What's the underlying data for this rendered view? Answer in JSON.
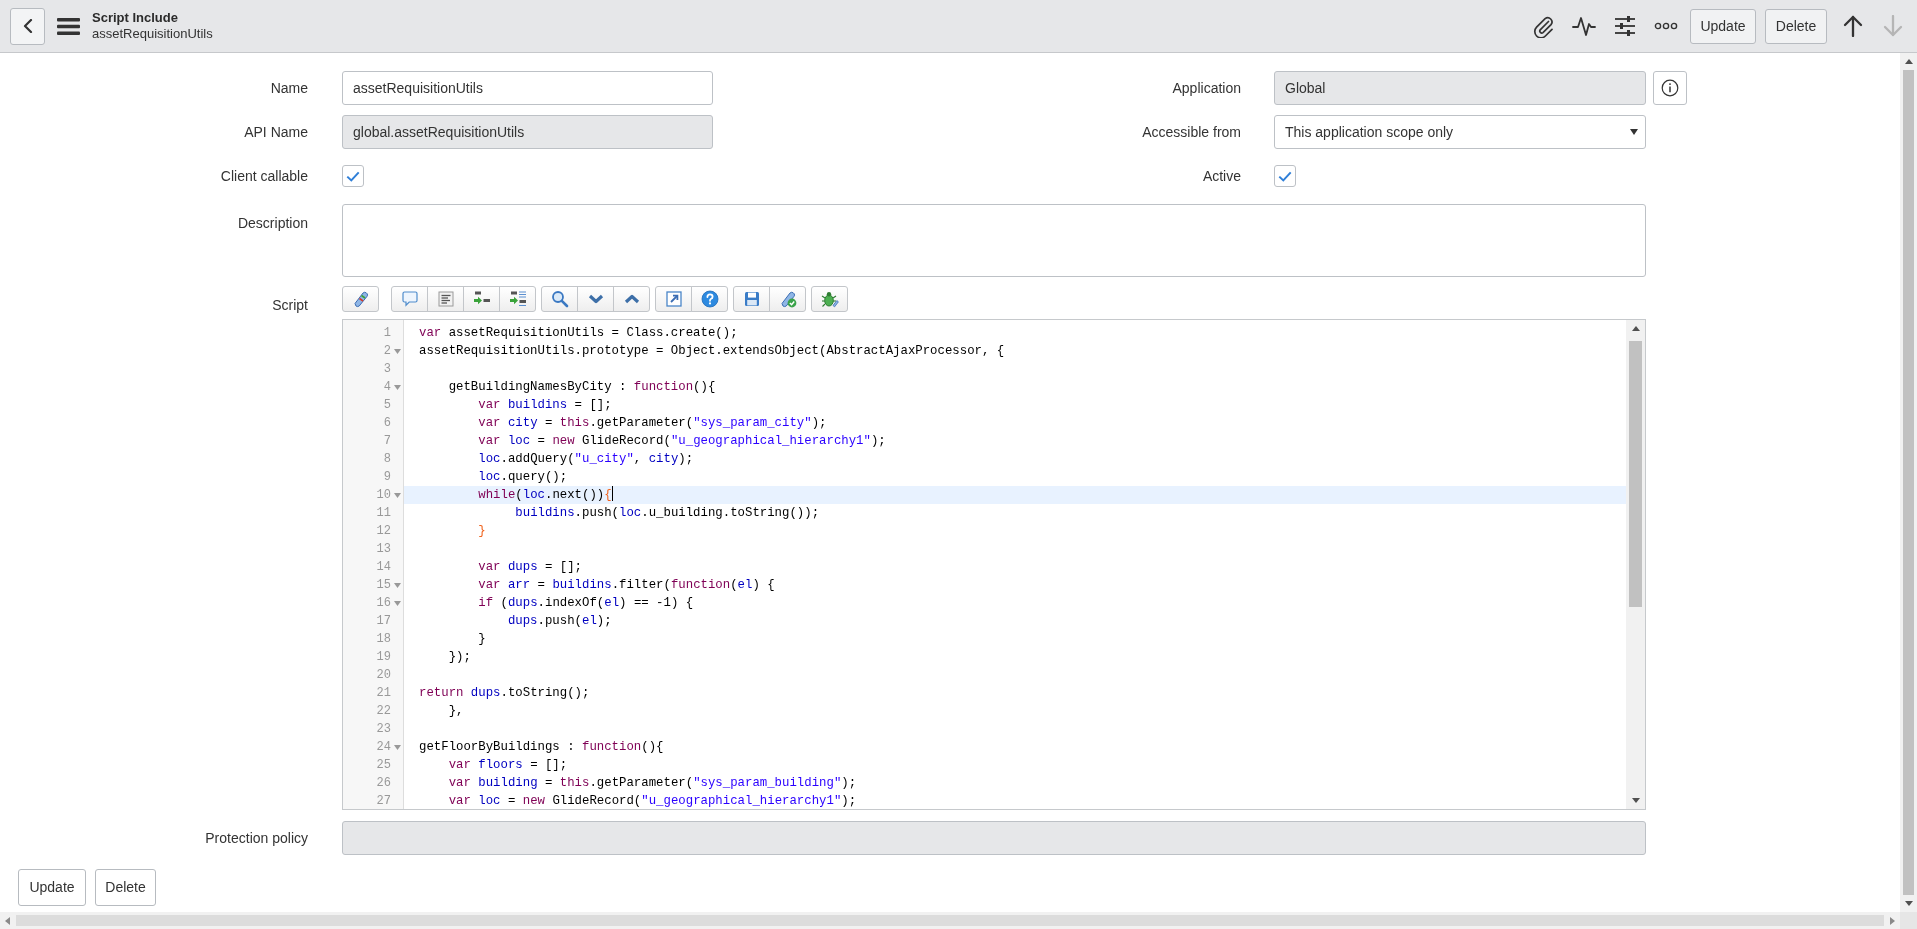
{
  "header": {
    "title": "Script Include",
    "subtitle": "assetRequisitionUtils",
    "buttons": [
      "Update",
      "Delete"
    ],
    "previous_record": {
      "disabled": false
    },
    "next_record": {
      "disabled": true
    }
  },
  "form": {
    "name": {
      "label": "Name",
      "value": "assetRequisitionUtils",
      "read_only": false
    },
    "application": {
      "label": "Application",
      "value": "Global",
      "read_only": true
    },
    "api_name": {
      "label": "API Name",
      "value": "global.assetRequisitionUtils",
      "read_only": true
    },
    "accessible_from": {
      "label": "Accessible from",
      "value": "This application scope only"
    },
    "client_callable": {
      "label": "Client callable",
      "checked": true
    },
    "active": {
      "label": "Active",
      "checked": true
    },
    "description": {
      "label": "Description",
      "read_only": false
    },
    "script": {
      "label": "Script",
      "lines": [
        {
          "number": "1",
          "foldable": false,
          "active": false,
          "tokens": [
            {
              "kind": "keyword",
              "text": "var"
            },
            {
              "kind": "plain",
              "text": " assetRequisitionUtils = Class.create();"
            }
          ]
        },
        {
          "number": "2",
          "foldable": true,
          "active": false,
          "tokens": [
            {
              "kind": "plain",
              "text": "assetRequisitionUtils.prototype = Object.extendsObject(AbstractAjaxProcessor, {"
            }
          ]
        },
        {
          "number": "3",
          "foldable": false,
          "active": false
        },
        {
          "number": "4",
          "foldable": true,
          "active": false,
          "tokens": [
            {
              "kind": "plain",
              "text": "    getBuildingNamesByCity : "
            },
            {
              "kind": "keyword",
              "text": "function"
            },
            {
              "kind": "plain",
              "text": "(){"
            }
          ]
        },
        {
          "number": "5",
          "foldable": false,
          "active": false,
          "tokens": [
            {
              "kind": "keyword",
              "text": "        var"
            },
            {
              "kind": "variable",
              "text": " buildins"
            },
            {
              "kind": "plain",
              "text": " = [];"
            }
          ]
        },
        {
          "number": "6",
          "foldable": false,
          "active": false,
          "tokens": [
            {
              "kind": "keyword",
              "text": "        var"
            },
            {
              "kind": "variable",
              "text": " city"
            },
            {
              "kind": "plain",
              "text": " = "
            },
            {
              "kind": "keyword",
              "text": "this"
            },
            {
              "kind": "plain",
              "text": ".getParameter("
            },
            {
              "kind": "string",
              "text": "\"sys_param_city\""
            },
            {
              "kind": "plain",
              "text": ");"
            }
          ]
        },
        {
          "number": "7",
          "foldable": false,
          "active": false,
          "tokens": [
            {
              "kind": "keyword",
              "text": "        var"
            },
            {
              "kind": "variable",
              "text": " loc"
            },
            {
              "kind": "plain",
              "text": " = "
            },
            {
              "kind": "keyword",
              "text": "new"
            },
            {
              "kind": "plain",
              "text": " GlideRecord("
            },
            {
              "kind": "string",
              "text": "\"u_geographical_hierarchy1\""
            },
            {
              "kind": "plain",
              "text": ");"
            }
          ]
        },
        {
          "number": "8",
          "foldable": false,
          "active": false,
          "tokens": [
            {
              "kind": "variable",
              "text": "        loc"
            },
            {
              "kind": "plain",
              "text": ".addQuery("
            },
            {
              "kind": "string",
              "text": "\"u_city\""
            },
            {
              "kind": "plain",
              "text": ", "
            },
            {
              "kind": "variable",
              "text": "city"
            },
            {
              "kind": "plain",
              "text": ");"
            }
          ]
        },
        {
          "number": "9",
          "foldable": false,
          "active": false,
          "tokens": [
            {
              "kind": "variable",
              "text": "        loc"
            },
            {
              "kind": "plain",
              "text": ".query();"
            }
          ]
        },
        {
          "number": "10",
          "foldable": true,
          "active": true,
          "tokens": [
            {
              "kind": "keyword",
              "text": "        while"
            },
            {
              "kind": "plain",
              "text": "("
            },
            {
              "kind": "variable",
              "text": "loc"
            },
            {
              "kind": "plain",
              "text": ".next())"
            },
            {
              "kind": "bracket",
              "text": "{"
            }
          ]
        },
        {
          "number": "11",
          "foldable": false,
          "active": false,
          "tokens": [
            {
              "kind": "variable",
              "text": "             buildins"
            },
            {
              "kind": "plain",
              "text": ".push("
            },
            {
              "kind": "variable",
              "text": "loc"
            },
            {
              "kind": "plain",
              "text": ".u_building.toString());"
            }
          ]
        },
        {
          "number": "12",
          "foldable": false,
          "active": false,
          "tokens": [
            {
              "kind": "bracket",
              "text": "        }"
            }
          ]
        },
        {
          "number": "13",
          "foldable": false,
          "active": false
        },
        {
          "number": "14",
          "foldable": false,
          "active": false,
          "tokens": [
            {
              "kind": "keyword",
              "text": "        var"
            },
            {
              "kind": "variable",
              "text": " dups"
            },
            {
              "kind": "plain",
              "text": " = [];"
            }
          ]
        },
        {
          "number": "15",
          "foldable": true,
          "active": false,
          "tokens": [
            {
              "kind": "keyword",
              "text": "        var"
            },
            {
              "kind": "variable",
              "text": " arr"
            },
            {
              "kind": "plain",
              "text": " = "
            },
            {
              "kind": "variable",
              "text": "buildins"
            },
            {
              "kind": "plain",
              "text": ".filter("
            },
            {
              "kind": "keyword",
              "text": "function"
            },
            {
              "kind": "plain",
              "text": "("
            },
            {
              "kind": "variable",
              "text": "el"
            },
            {
              "kind": "plain",
              "text": ") {"
            }
          ]
        },
        {
          "number": "16",
          "foldable": true,
          "active": false,
          "tokens": [
            {
              "kind": "keyword",
              "text": "        if"
            },
            {
              "kind": "plain",
              "text": " ("
            },
            {
              "kind": "variable",
              "text": "dups"
            },
            {
              "kind": "plain",
              "text": ".indexOf("
            },
            {
              "kind": "variable",
              "text": "el"
            },
            {
              "kind": "plain",
              "text": ") == -1) {"
            }
          ]
        },
        {
          "number": "17",
          "foldable": false,
          "active": false,
          "tokens": [
            {
              "kind": "variable",
              "text": "            dups"
            },
            {
              "kind": "plain",
              "text": ".push("
            },
            {
              "kind": "variable",
              "text": "el"
            },
            {
              "kind": "plain",
              "text": ");"
            }
          ]
        },
        {
          "number": "18",
          "foldable": false,
          "active": false,
          "tokens": [
            {
              "kind": "plain",
              "text": "        }"
            }
          ]
        },
        {
          "number": "19",
          "foldable": false,
          "active": false,
          "tokens": [
            {
              "kind": "plain",
              "text": "    });"
            }
          ]
        },
        {
          "number": "20",
          "foldable": false,
          "active": false
        },
        {
          "number": "21",
          "foldable": false,
          "active": false,
          "tokens": [
            {
              "kind": "keyword",
              "text": "return"
            },
            {
              "kind": "variable",
              "text": " dups"
            },
            {
              "kind": "plain",
              "text": ".toString();"
            }
          ]
        },
        {
          "number": "22",
          "foldable": false,
          "active": false,
          "tokens": [
            {
              "kind": "plain",
              "text": "    },"
            }
          ]
        },
        {
          "number": "23",
          "foldable": false,
          "active": false
        },
        {
          "number": "24",
          "foldable": true,
          "active": false,
          "tokens": [
            {
              "kind": "plain",
              "text": "getFloorByBuildings : "
            },
            {
              "kind": "keyword",
              "text": "function"
            },
            {
              "kind": "plain",
              "text": "(){"
            }
          ]
        },
        {
          "number": "25",
          "foldable": false,
          "active": false,
          "tokens": [
            {
              "kind": "keyword",
              "text": "    var"
            },
            {
              "kind": "variable",
              "text": " floors"
            },
            {
              "kind": "plain",
              "text": " = [];"
            }
          ]
        },
        {
          "number": "26",
          "foldable": false,
          "active": false,
          "tokens": [
            {
              "kind": "keyword",
              "text": "    var"
            },
            {
              "kind": "variable",
              "text": " building"
            },
            {
              "kind": "plain",
              "text": " = "
            },
            {
              "kind": "keyword",
              "text": "this"
            },
            {
              "kind": "plain",
              "text": ".getParameter("
            },
            {
              "kind": "string",
              "text": "\"sys_param_building\""
            },
            {
              "kind": "plain",
              "text": ");"
            }
          ]
        },
        {
          "number": "27",
          "foldable": false,
          "active": false,
          "tokens": [
            {
              "kind": "keyword",
              "text": "    var"
            },
            {
              "kind": "variable",
              "text": " loc"
            },
            {
              "kind": "plain",
              "text": " = "
            },
            {
              "kind": "keyword",
              "text": "new"
            },
            {
              "kind": "plain",
              "text": " GlideRecord("
            },
            {
              "kind": "string",
              "text": "\"u_geographical_hierarchy1\""
            },
            {
              "kind": "plain",
              "text": ");"
            }
          ]
        }
      ]
    },
    "protection_policy": {
      "label": "Protection policy",
      "read_only": true
    }
  },
  "footer_buttons": [
    "Update",
    "Delete"
  ]
}
